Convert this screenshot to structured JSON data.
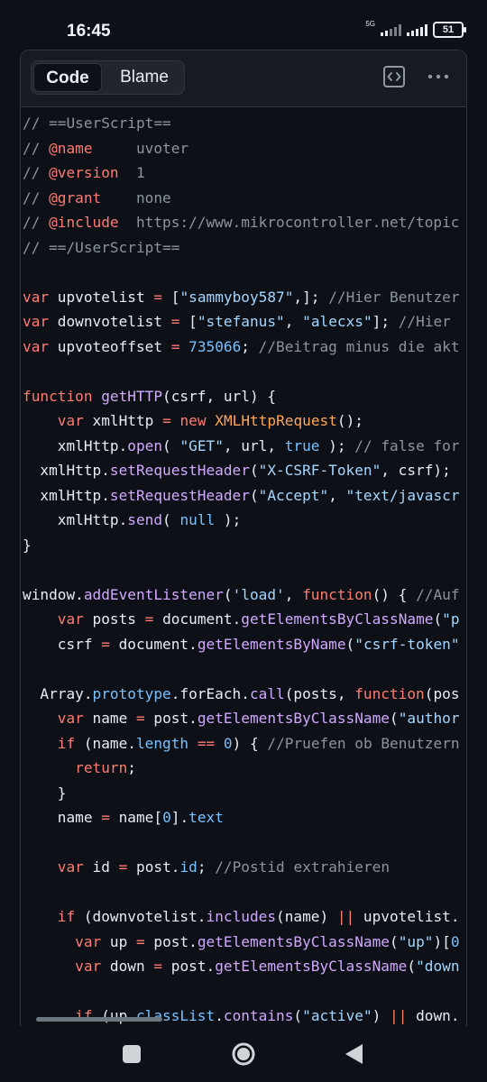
{
  "status": {
    "time": "16:45",
    "network": "5G",
    "battery": "51"
  },
  "header": {
    "tab_code": "Code",
    "tab_blame": "Blame",
    "code_view_icon": "code-brackets-icon",
    "more_icon": "kebab-horizontal-icon"
  },
  "code_lines": [
    "// ==UserScript==",
    "// @name     uvoter",
    "// @version  1",
    "// @grant    none",
    "// @include  https://www.mikrocontroller.net/topic",
    "// ==/UserScript==",
    "",
    "var upvotelist = [\"sammyboy587\",]; //Hier Benutzer",
    "var downvotelist = [\"stefanus\", \"alecxs\"]; //Hier",
    "var upvoteoffset = 735066; //Beitrag minus die akt",
    "",
    "function getHTTP(csrf, url) {",
    "    var xmlHttp = new XMLHttpRequest();",
    "    xmlHttp.open( \"GET\", url, true ); // false for",
    "  xmlHttp.setRequestHeader(\"X-CSRF-Token\", csrf);",
    "  xmlHttp.setRequestHeader(\"Accept\", \"text/javascr",
    "    xmlHttp.send( null );",
    "}",
    "",
    "window.addEventListener('load', function() { //Auf",
    "    var posts = document.getElementsByClassName(\"p",
    "    csrf = document.getElementsByName(\"csrf-token\"",
    "",
    "  Array.prototype.forEach.call(posts, function(pos",
    "    var name = post.getElementsByClassName(\"author",
    "    if (name.length == 0) { //Pruefen ob Benutzern",
    "      return;",
    "    }",
    "    name = name[0].text",
    "",
    "    var id = post.id; //Postid extrahieren",
    "",
    "    if (downvotelist.includes(name) || upvotelist.",
    "      var up = post.getElementsByClassName(\"up\")[0",
    "      var down = post.getElementsByClassName(\"down",
    "",
    "      if (up.classList.contains(\"active\") || down."
  ],
  "colors": {
    "background": "#0d1117",
    "comment": "#8b949e",
    "keyword": "#ff7b72",
    "string": "#a5d6ff",
    "function": "#d2a8ff",
    "number": "#79c0ff",
    "class": "#ffa657"
  },
  "navbar": {
    "recent_icon": "recent-apps-icon",
    "home_icon": "home-icon",
    "back_icon": "back-icon"
  }
}
